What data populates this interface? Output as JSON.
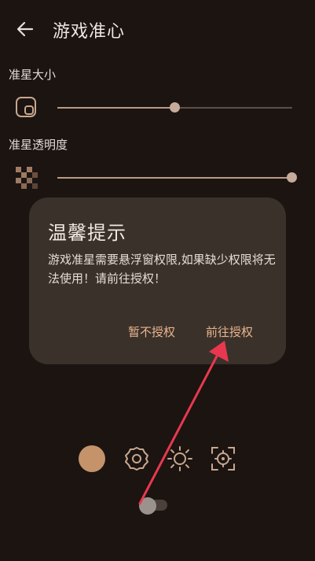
{
  "header": {
    "title": "游戏准心"
  },
  "size_section": {
    "label": "准星大小",
    "value": 0.5
  },
  "opacity_section": {
    "label": "准星透明度",
    "value": 1.0
  },
  "dialog": {
    "title": "温馨提示",
    "message": "游戏准星需要悬浮窗权限,如果缺少权限将无法使用！请前往授权！",
    "cancel_label": "暂不授权",
    "confirm_label": "前往授权"
  },
  "colors": {
    "background": "#1b1411",
    "accent": "#c4936a",
    "dialog": "#3a312b",
    "arrow": "#e8384f"
  },
  "toolbar": {
    "icons": [
      "color-dot-icon",
      "settings-gear-icon",
      "brightness-icon",
      "crosshair-target-icon"
    ]
  },
  "toggle": {
    "state": "off"
  }
}
